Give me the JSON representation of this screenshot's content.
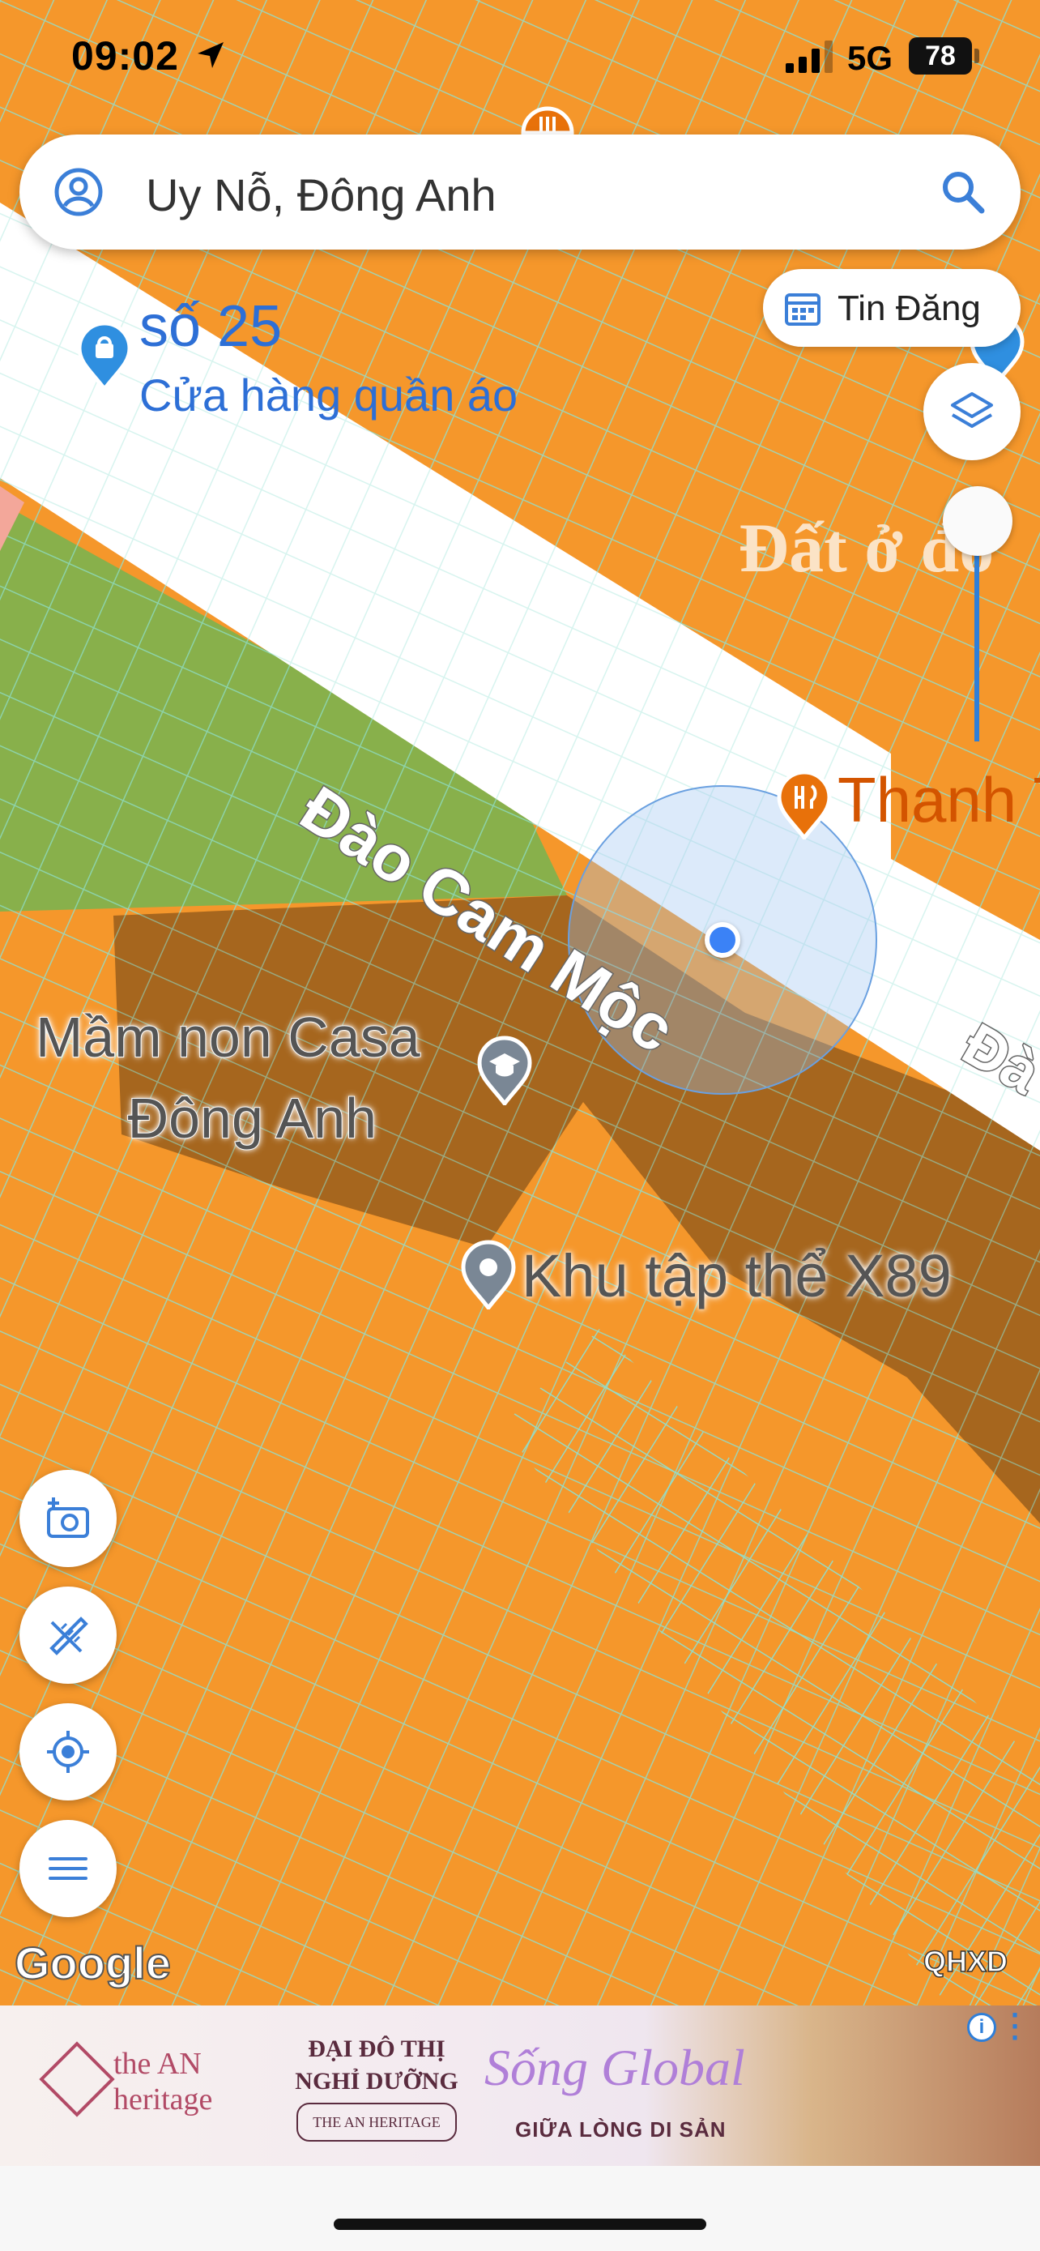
{
  "status_bar": {
    "time": "09:02",
    "network": "5G",
    "battery": "78"
  },
  "search": {
    "query": "Uy Nỗ, Đông Anh"
  },
  "top_right": {
    "tin_dang_label": "Tin Đăng"
  },
  "map": {
    "street_name_main": "Đào Cam Mộc",
    "street_name_partial": "Đà",
    "zone_label": "Đất ở đô",
    "poi_blue": {
      "name": "số 25",
      "category": "Cửa hàng quần áo"
    },
    "poi_orange": {
      "name": "Thanh T"
    },
    "school": {
      "line1": "Mầm non Casa",
      "line2": "Đông Anh"
    },
    "place": {
      "name": "Khu tập thể X89"
    },
    "attribution": "Google",
    "layer_tag": "QHXD",
    "colors": {
      "residential": "#f5972b",
      "road": "#ffffff",
      "green": "#88b04b",
      "commercial": "#a6661e",
      "parcel_lines": "#8ee0d0",
      "user_location": "#3b82f6"
    }
  },
  "fabs": [
    {
      "name": "add-photo",
      "icon": "camera-plus-icon"
    },
    {
      "name": "measure",
      "icon": "ruler-pencil-icon"
    },
    {
      "name": "my-location",
      "icon": "crosshair-icon"
    },
    {
      "name": "menu",
      "icon": "hamburger-icon"
    }
  ],
  "ad": {
    "brand_line1": "the AN",
    "brand_line2": "heritage",
    "center_line1": "ĐẠI ĐÔ THỊ",
    "center_line2": "NGHỈ DƯỠNG",
    "center_pill": "THE AN HERITAGE",
    "script_title": "Sống Global",
    "tagline": "GIỮA LÒNG DI SẢN",
    "info_glyph": "i"
  }
}
